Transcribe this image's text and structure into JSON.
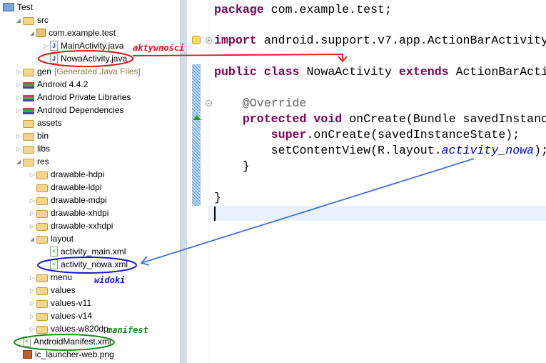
{
  "tree": [
    {
      "label": "Test",
      "level": 0,
      "arrow": "",
      "icon": "project-icon"
    },
    {
      "label": "src",
      "level": 1,
      "arrow": "open",
      "icon": "source-folder-icon"
    },
    {
      "label": "com.example.test",
      "level": 2,
      "arrow": "open",
      "icon": "package-icon"
    },
    {
      "label": "MainActivity.java",
      "level": 3,
      "arrow": "closed",
      "icon": "java-file-icon"
    },
    {
      "label": "NowaActivity.java",
      "level": 3,
      "arrow": "",
      "icon": "java-file-icon"
    },
    {
      "label": "gen",
      "extra": "[Generated Java Files]",
      "level": 1,
      "arrow": "closed",
      "icon": "source-folder-icon"
    },
    {
      "label": "Android 4.4.2",
      "level": 1,
      "arrow": "closed",
      "icon": "library-icon"
    },
    {
      "label": "Android Private Libraries",
      "level": 1,
      "arrow": "closed",
      "icon": "library-icon"
    },
    {
      "label": "Android Dependencies",
      "level": 1,
      "arrow": "closed",
      "icon": "library-icon"
    },
    {
      "label": "assets",
      "level": 1,
      "arrow": "",
      "icon": "folder-icon"
    },
    {
      "label": "bin",
      "level": 1,
      "arrow": "closed",
      "icon": "folder-icon"
    },
    {
      "label": "libs",
      "level": 1,
      "arrow": "closed",
      "icon": "folder-icon"
    },
    {
      "label": "res",
      "level": 1,
      "arrow": "open",
      "icon": "folder-icon"
    },
    {
      "label": "drawable-hdpi",
      "level": 2,
      "arrow": "closed",
      "icon": "folder-icon"
    },
    {
      "label": "drawable-ldpi",
      "level": 2,
      "arrow": "",
      "icon": "folder-icon"
    },
    {
      "label": "drawable-mdpi",
      "level": 2,
      "arrow": "closed",
      "icon": "folder-icon"
    },
    {
      "label": "drawable-xhdpi",
      "level": 2,
      "arrow": "closed",
      "icon": "folder-icon"
    },
    {
      "label": "drawable-xxhdpi",
      "level": 2,
      "arrow": "closed",
      "icon": "folder-icon"
    },
    {
      "label": "layout",
      "level": 2,
      "arrow": "open",
      "icon": "folder-icon"
    },
    {
      "label": "activity_main.xml",
      "level": 3,
      "arrow": "",
      "icon": "xml-file-icon"
    },
    {
      "label": "activity_nowa.xml",
      "level": 3,
      "arrow": "",
      "icon": "xml-file-icon"
    },
    {
      "label": "menu",
      "level": 2,
      "arrow": "closed",
      "icon": "folder-icon"
    },
    {
      "label": "values",
      "level": 2,
      "arrow": "closed",
      "icon": "folder-icon"
    },
    {
      "label": "values-v11",
      "level": 2,
      "arrow": "closed",
      "icon": "folder-icon"
    },
    {
      "label": "values-v14",
      "level": 2,
      "arrow": "closed",
      "icon": "folder-icon"
    },
    {
      "label": "values-w820dp",
      "level": 2,
      "arrow": "closed",
      "icon": "folder-icon"
    },
    {
      "label": "AndroidManifest.xml",
      "level": 1,
      "arrow": "",
      "icon": "xml-file-icon"
    },
    {
      "label": "ic_launcher-web.png",
      "level": 1,
      "arrow": "",
      "icon": "image-file-icon"
    }
  ],
  "code": {
    "l1": {
      "kw": "package",
      "rest": " com.example.test;"
    },
    "l2": {
      "kw": "import",
      "rest": " android.support.v7.app.ActionBarActivity"
    },
    "l3": {
      "kw1": "public",
      "kw2": " class",
      "mid": " NowaActivity ",
      "kw3": "extends",
      "rest": " ActionBarActi"
    },
    "l4": {
      "an": "    @Override"
    },
    "l5": {
      "kw1": "    protected",
      "kw2": " void",
      "rest": " onCreate(Bundle savedInstanc"
    },
    "l6": {
      "kw": "        super",
      "rest": ".onCreate(savedInstanceState);"
    },
    "l7": {
      "pre": "        setContentView(R.layout.",
      "it": "activity_nowa",
      "post": ");"
    },
    "l8": "    }",
    "l9": "}"
  },
  "annotations": {
    "activities": "aktywności",
    "views": "widoki",
    "manifest": "manifest",
    "colors": {
      "activities": "#e8141c",
      "views": "#1a1ad8",
      "manifest": "#1a8a1a",
      "arrow": "#3f6fe8"
    }
  }
}
